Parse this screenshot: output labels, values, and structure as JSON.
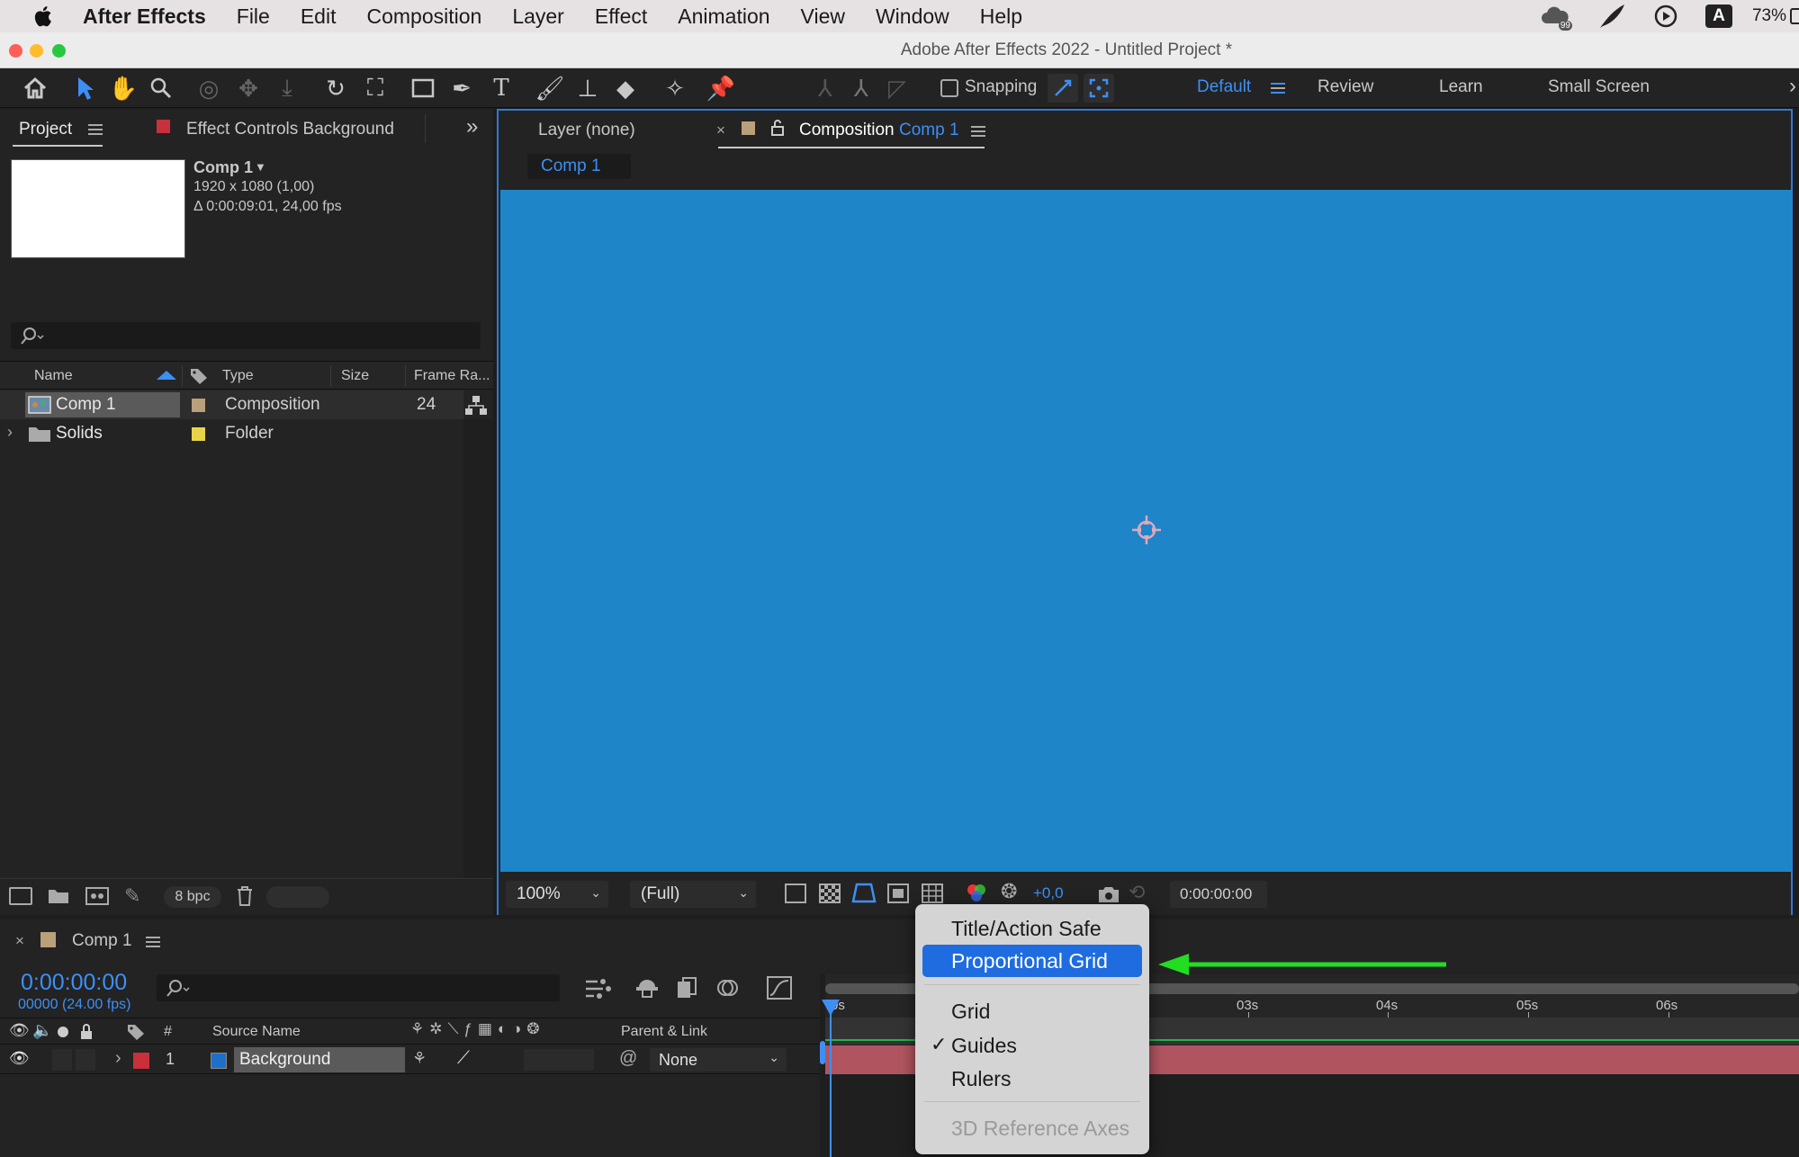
{
  "menubar": {
    "app": "After Effects",
    "items": [
      "File",
      "Edit",
      "Composition",
      "Layer",
      "Effect",
      "Animation",
      "View",
      "Window",
      "Help"
    ],
    "battery": "73%",
    "input_badge": "A",
    "cc_badge": "99"
  },
  "window": {
    "title": "Adobe After Effects 2022 - Untitled Project *"
  },
  "toolbar": {
    "snapping_label": "Snapping",
    "workspaces": [
      "Default",
      "Review",
      "Learn",
      "Small Screen"
    ],
    "active_workspace": "Default"
  },
  "project_panel": {
    "tab_project": "Project",
    "tab_effect_controls": "Effect Controls Background",
    "comp_name": "Comp 1",
    "comp_dims": "1920 x 1080 (1,00)",
    "comp_duration": "Δ 0:00:09:01, 24,00 fps",
    "columns": [
      "Name",
      "Type",
      "Size",
      "Frame Ra..."
    ],
    "rows": [
      {
        "name": "Comp 1",
        "type": "Composition",
        "frame_rate": "24",
        "label_color": "#b9a07a"
      },
      {
        "name": "Solids",
        "type": "Folder",
        "frame_rate": "",
        "label_color": "#e8d44a"
      }
    ],
    "bpc": "8 bpc"
  },
  "viewer": {
    "tab_layer": "Layer (none)",
    "tab_comp_prefix": "Composition",
    "tab_comp_name": "Comp 1",
    "breadcrumb": "Comp 1",
    "canvas_color": "#1e85c8",
    "zoom": "100%",
    "resolution": "(Full)",
    "exposure": "+0,0",
    "timecode": "0:00:00:00"
  },
  "timeline": {
    "tab_name": "Comp 1",
    "timecode": "0:00:00:00",
    "frame_info": "00000 (24.00 fps)",
    "columns": {
      "number": "#",
      "source_name": "Source Name",
      "parent_link": "Parent & Link"
    },
    "layer": {
      "index": "1",
      "name": "Background",
      "parent": "None",
      "label_color": "#c8303a",
      "swatch_color": "#1e6fc8"
    },
    "ruler": [
      "0s",
      "03s",
      "04s",
      "05s",
      "06s"
    ]
  },
  "context_menu": {
    "items": [
      {
        "label": "Title/Action Safe",
        "checked": false,
        "highlighted": false,
        "disabled": false
      },
      {
        "label": "Proportional Grid",
        "checked": false,
        "highlighted": true,
        "disabled": false
      },
      {
        "label": "Grid",
        "checked": false,
        "highlighted": false,
        "disabled": false
      },
      {
        "label": "Guides",
        "checked": true,
        "highlighted": false,
        "disabled": false
      },
      {
        "label": "Rulers",
        "checked": false,
        "highlighted": false,
        "disabled": false
      },
      {
        "label": "3D Reference Axes",
        "checked": false,
        "highlighted": false,
        "disabled": true
      }
    ],
    "checkmark": "✓"
  },
  "colors": {
    "accent": "#3d8ff5",
    "highlight": "#1e6ce0",
    "annotation_arrow": "#22dd22"
  }
}
